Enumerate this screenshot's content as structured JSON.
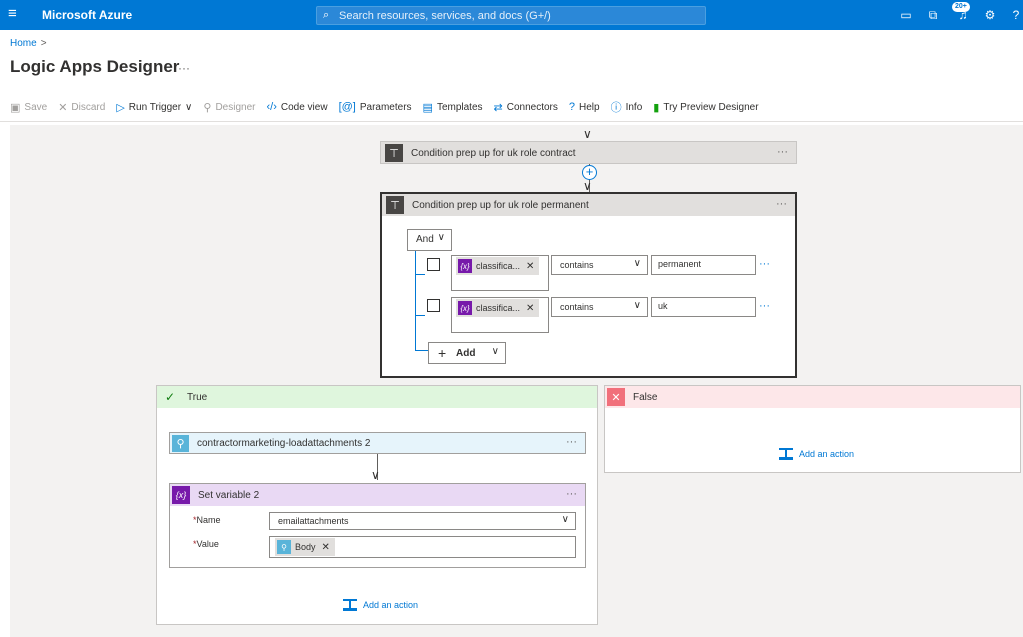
{
  "topbar": {
    "brand": "Microsoft Azure",
    "search_placeholder": "Search resources, services, and docs (G+/)",
    "notification_count": "20+"
  },
  "breadcrumb": {
    "home": "Home",
    "separator": ">"
  },
  "page": {
    "title": "Logic Apps Designer",
    "more": "···"
  },
  "toolbar": {
    "save": "Save",
    "discard": "Discard",
    "run_trigger": "Run Trigger",
    "designer": "Designer",
    "code_view": "Code view",
    "parameters": "Parameters",
    "templates": "Templates",
    "connectors": "Connectors",
    "help": "Help",
    "info": "Info",
    "try_preview": "Try Preview Designer"
  },
  "colors": {
    "accent": "#0078d4",
    "true_branch": "#dff6dd",
    "false_branch": "#fde7e9",
    "variable": "#7719aa",
    "connector_blue": "#59b4d9"
  },
  "flow": {
    "condition_contract": {
      "title": "Condition prep up for uk role contract",
      "more": "···"
    },
    "condition_permanent": {
      "title": "Condition prep up for uk role permanent",
      "more": "···",
      "group_operator": "And",
      "rows": [
        {
          "token": "classifica...",
          "operator": "contains",
          "value": "permanent"
        },
        {
          "token": "classifica...",
          "operator": "contains",
          "value": "uk"
        }
      ],
      "add_label": "Add",
      "row_more": "···"
    },
    "true_branch": {
      "label": "True",
      "action1": {
        "title": "contractormarketing-loadattachments 2",
        "more": "···"
      },
      "set_variable": {
        "title": "Set variable 2",
        "more": "···",
        "required_mark": "*",
        "name_label": "Name",
        "name_value": "emailattachments",
        "value_label": "Value",
        "value_token": "Body"
      },
      "add_action": "Add an action"
    },
    "false_branch": {
      "label": "False",
      "add_action": "Add an action"
    }
  }
}
